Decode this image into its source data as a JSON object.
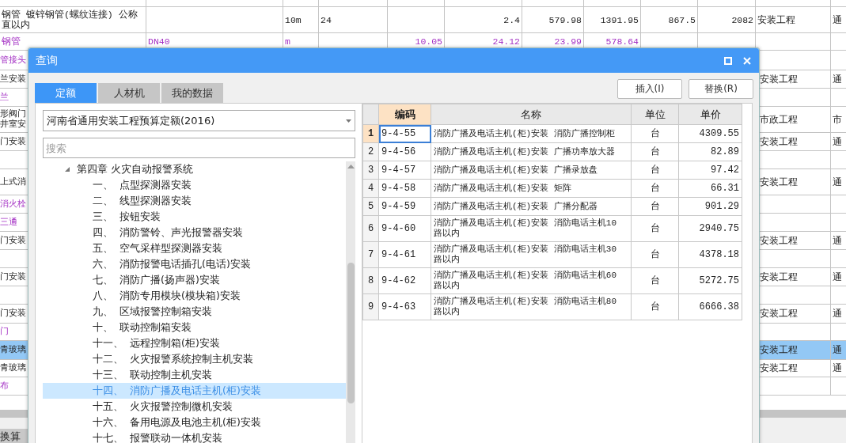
{
  "sheet": {
    "top_rows": [
      {
        "kind": "item",
        "name": "钢管 镀锌钢管(螺纹连接) 公称直以内",
        "unit": "10m",
        "column_4": "24",
        "column_6": "2.4",
        "column_7": "579.98",
        "column_8": "1391.95",
        "column_9": "867.5",
        "column_10": "2082",
        "category": "安装工程",
        "column_12": "通"
      },
      {
        "kind": "material",
        "name": "钢管",
        "spec": "DN40",
        "unit": "m",
        "column_5": "10.05",
        "column_6": "24.12",
        "column_7": "23.99",
        "column_8": "578.64"
      }
    ],
    "side_rows": [
      {
        "kind": "material",
        "name": "管接头",
        "selected": false
      },
      {
        "kind": "item",
        "name": "兰安装",
        "category": "安装工程",
        "column_12": "通",
        "selected": false
      },
      {
        "kind": "material",
        "name": "兰",
        "selected": false
      },
      {
        "kind": "item",
        "name": "形阀门井室安",
        "category": "市政工程",
        "column_12": "市",
        "selected": false
      },
      {
        "kind": "item",
        "name": "门安装",
        "category": "安装工程",
        "column_12": "通",
        "selected": false
      },
      {
        "selected": false
      },
      {
        "kind": "item",
        "name": "上式消",
        "category": "安装工程",
        "column_12": "通",
        "selected": false
      },
      {
        "kind": "material",
        "name": "消火栓",
        "selected": false
      },
      {
        "kind": "material",
        "name": "三通",
        "selected": false
      },
      {
        "kind": "item",
        "name": "门安装",
        "category": "安装工程",
        "column_12": "通",
        "selected": false
      },
      {
        "selected": false
      },
      {
        "kind": "item",
        "name": "门安装",
        "category": "安装工程",
        "column_12": "通",
        "selected": false
      },
      {
        "selected": false
      },
      {
        "kind": "item",
        "name": "门安装",
        "category": "安装工程",
        "column_12": "通",
        "selected": false
      },
      {
        "kind": "material",
        "name": "门",
        "selected": false
      },
      {
        "kind": "item",
        "name": "青玻璃",
        "category": "安装工程",
        "column_12": "通",
        "selected": true
      },
      {
        "kind": "item",
        "name": "青玻璃",
        "category": "安装工程",
        "column_12": "通",
        "selected": false
      },
      {
        "kind": "material",
        "name": "布",
        "selected": false
      }
    ],
    "bottom_tab": "换算"
  },
  "dialog": {
    "title": "查询",
    "tabs": [
      {
        "label": "定额",
        "selected": true
      },
      {
        "label": "人材机",
        "selected": false
      },
      {
        "label": "我的数据",
        "selected": false
      }
    ],
    "buttons": [
      "插入(I)",
      "替换(R)"
    ],
    "library": "河南省通用安装工程预算定额(2016)",
    "search": {
      "placeholder": "搜索"
    },
    "tree": [
      {
        "label": "第四章 火灾自动报警系统",
        "expanded": true,
        "selected": false,
        "children": [
          {
            "number": "一、",
            "label": "点型探测器安装",
            "selected": false
          },
          {
            "number": "二、",
            "label": "线型探测器安装",
            "selected": false
          },
          {
            "number": "三、",
            "label": "按钮安装",
            "selected": false
          },
          {
            "number": "四、",
            "label": "消防警铃、声光报警器安装",
            "selected": false
          },
          {
            "number": "五、",
            "label": "空气采样型探测器安装",
            "selected": false
          },
          {
            "number": "六、",
            "label": "消防报警电话插孔(电话)安装",
            "selected": false
          },
          {
            "number": "七、",
            "label": "消防广播(扬声器)安装",
            "selected": false
          },
          {
            "number": "八、",
            "label": "消防专用模块(模块箱)安装",
            "selected": false
          },
          {
            "number": "九、",
            "label": "区域报警控制箱安装",
            "selected": false
          },
          {
            "number": "十、",
            "label": "联动控制箱安装",
            "selected": false
          },
          {
            "number": "十一、",
            "label": "远程控制箱(柜)安装",
            "selected": false
          },
          {
            "number": "十二、",
            "label": "火灾报警系统控制主机安装",
            "selected": false
          },
          {
            "number": "十三、",
            "label": "联动控制主机安装",
            "selected": false
          },
          {
            "number": "十四、",
            "label": "消防广播及电话主机(柜)安装",
            "selected": true
          },
          {
            "number": "十五、",
            "label": "火灾报警控制微机安装",
            "selected": false
          },
          {
            "number": "十六、",
            "label": "备用电源及电池主机(柜)安装",
            "selected": false
          },
          {
            "number": "十七、",
            "label": "报警联动一体机安装",
            "selected": false
          }
        ]
      }
    ],
    "table": {
      "columns": [
        {
          "label": "编码",
          "selected": true
        },
        {
          "label": "名称",
          "selected": false
        },
        {
          "label": "单位",
          "selected": false
        },
        {
          "label": "单价",
          "selected": false
        }
      ],
      "rows": [
        {
          "number": "1",
          "code": "9-4-55",
          "name": "消防广播及电话主机(柜)安装 消防广播控制柜",
          "unit": "台",
          "price": "4309.55",
          "selected": true
        },
        {
          "number": "2",
          "code": "9-4-56",
          "name": "消防广播及电话主机(柜)安装 广播功率放大器",
          "unit": "台",
          "price": "82.89",
          "selected": false
        },
        {
          "number": "3",
          "code": "9-4-57",
          "name": "消防广播及电话主机(柜)安装 广播录放盘",
          "unit": "台",
          "price": "97.42",
          "selected": false
        },
        {
          "number": "4",
          "code": "9-4-58",
          "name": "消防广播及电话主机(柜)安装 矩阵",
          "unit": "台",
          "price": "66.31",
          "selected": false
        },
        {
          "number": "5",
          "code": "9-4-59",
          "name": "消防广播及电话主机(柜)安装 广播分配器",
          "unit": "台",
          "price": "901.29",
          "selected": false
        },
        {
          "number": "6",
          "code": "9-4-60",
          "name": "消防广播及电话主机(柜)安装 消防电话主机10路以内",
          "unit": "台",
          "price": "2940.75",
          "selected": false
        },
        {
          "number": "7",
          "code": "9-4-61",
          "name": "消防广播及电话主机(柜)安装 消防电话主机30路以内",
          "unit": "台",
          "price": "4378.18",
          "selected": false
        },
        {
          "number": "8",
          "code": "9-4-62",
          "name": "消防广播及电话主机(柜)安装 消防电话主机60路以内",
          "unit": "台",
          "price": "5272.75",
          "selected": false
        },
        {
          "number": "9",
          "code": "9-4-63",
          "name": "消防广播及电话主机(柜)安装 消防电话主机80路以内",
          "unit": "台",
          "price": "6666.38",
          "selected": false
        }
      ]
    }
  }
}
